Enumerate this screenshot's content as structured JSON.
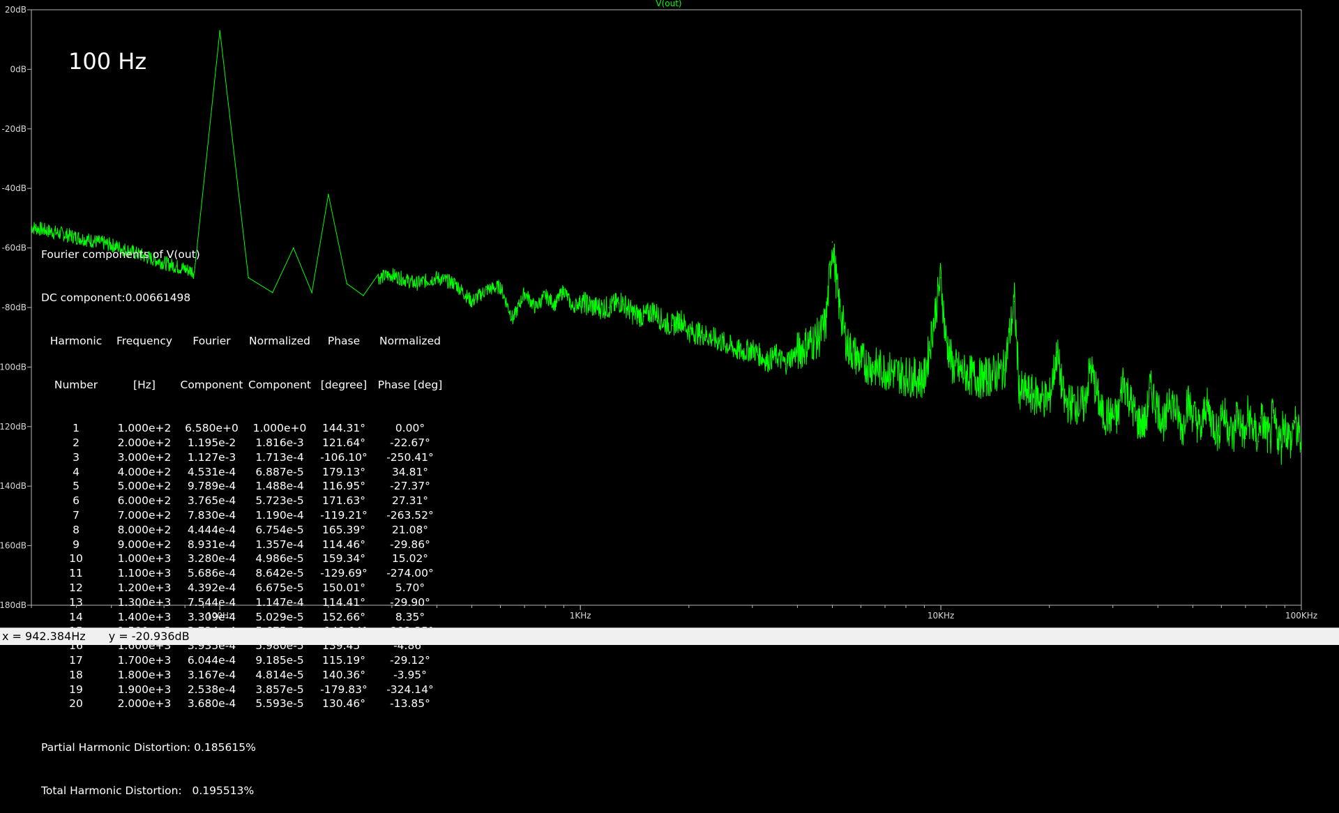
{
  "chart_data": {
    "type": "line",
    "title": "V(out)",
    "annotation": "100 Hz",
    "x_scale": "log",
    "xlim": [
      30,
      100000
    ],
    "ylim": [
      -180,
      20
    ],
    "x_ticks": [
      {
        "value": 100,
        "label": "100Hz"
      },
      {
        "value": 1000,
        "label": "1KHz"
      },
      {
        "value": 10000,
        "label": "10KHz"
      },
      {
        "value": 100000,
        "label": "100KHz"
      }
    ],
    "y_ticks": [
      {
        "value": 20,
        "label": "20dB"
      },
      {
        "value": 0,
        "label": "0dB"
      },
      {
        "value": -20,
        "label": "-20dB"
      },
      {
        "value": -40,
        "label": "-40dB"
      },
      {
        "value": -60,
        "label": "-60dB"
      },
      {
        "value": -80,
        "label": "-80dB"
      },
      {
        "value": -100,
        "label": "-100dB"
      },
      {
        "value": -120,
        "label": "-120dB"
      },
      {
        "value": -140,
        "label": "-140dB"
      },
      {
        "value": -160,
        "label": "-160dB"
      },
      {
        "value": -180,
        "label": "-180dB"
      }
    ],
    "grid": false,
    "trace_color": "#00ff00",
    "series": [
      {
        "name": "V(out)",
        "x": [
          30,
          50,
          70,
          85,
          100,
          120,
          140,
          160,
          180,
          200,
          225,
          250,
          275,
          300,
          350,
          400,
          450,
          500,
          550,
          600,
          650,
          700,
          750,
          800,
          850,
          900,
          950,
          1000,
          1100,
          1200,
          1300,
          1400,
          1500,
          1600,
          1700,
          1800,
          1900,
          2000,
          2200,
          2500,
          2800,
          3000,
          3300,
          3500,
          3700,
          3800,
          4000,
          4300,
          4600,
          4800,
          5000,
          5200,
          5500,
          6000,
          6500,
          7000,
          8000,
          9000,
          10000,
          10300,
          10800,
          11500,
          13000,
          15000,
          16000,
          16500,
          17500,
          20000,
          21000,
          22000,
          25000,
          26000,
          28000,
          31000,
          32000,
          35000,
          37000,
          38000,
          42000,
          43000,
          47000,
          48000,
          53000,
          54000,
          59000,
          60000,
          65000,
          66000,
          70000,
          71000,
          76000,
          77000,
          82000,
          83000,
          88000,
          89000,
          94000,
          95000,
          100000
        ],
        "y": [
          -53,
          -59,
          -65,
          -68,
          13,
          -70,
          -75,
          -60,
          -75,
          -42,
          -72,
          -76,
          -70,
          -69,
          -72,
          -70,
          -72,
          -78,
          -74,
          -73,
          -84,
          -75,
          -80,
          -76,
          -79,
          -74,
          -80,
          -78,
          -80,
          -80,
          -78,
          -82,
          -83,
          -81,
          -85,
          -86,
          -84,
          -88,
          -89,
          -92,
          -95,
          -94,
          -98,
          -96,
          -99,
          -97,
          -95,
          -92,
          -90,
          -85,
          -58,
          -78,
          -93,
          -98,
          -100,
          -101,
          -103,
          -104,
          -70,
          -90,
          -100,
          -102,
          -104,
          -101,
          -78,
          -108,
          -109,
          -111,
          -95,
          -112,
          -113,
          -100,
          -116,
          -117,
          -104,
          -118,
          -119,
          -107,
          -120,
          -109,
          -121,
          -111,
          -122,
          -112,
          -123,
          -114,
          -124,
          -115,
          -124,
          -116,
          -125,
          -117,
          -125,
          -117,
          -126,
          -118,
          -126,
          -118,
          -125
        ]
      }
    ]
  },
  "fourier": {
    "title": "Fourier components of V(out)",
    "dc": "DC component:0.00661498",
    "headers1": [
      "Harmonic",
      "Frequency",
      "Fourier",
      "Normalized",
      "Phase",
      "Normalized"
    ],
    "headers2": [
      "Number",
      "[Hz]",
      "Component",
      "Component",
      "[degree]",
      "Phase [deg]"
    ],
    "rows": [
      [
        "1",
        "1.000e+2",
        "6.580e+0",
        "1.000e+0",
        "144.31°",
        "0.00°"
      ],
      [
        "2",
        "2.000e+2",
        "1.195e-2",
        "1.816e-3",
        "121.64°",
        "-22.67°"
      ],
      [
        "3",
        "3.000e+2",
        "1.127e-3",
        "1.713e-4",
        "-106.10°",
        "-250.41°"
      ],
      [
        "4",
        "4.000e+2",
        "4.531e-4",
        "6.887e-5",
        "179.13°",
        "34.81°"
      ],
      [
        "5",
        "5.000e+2",
        "9.789e-4",
        "1.488e-4",
        "116.95°",
        "-27.37°"
      ],
      [
        "6",
        "6.000e+2",
        "3.765e-4",
        "5.723e-5",
        "171.63°",
        "27.31°"
      ],
      [
        "7",
        "7.000e+2",
        "7.830e-4",
        "1.190e-4",
        "-119.21°",
        "-263.52°"
      ],
      [
        "8",
        "8.000e+2",
        "4.444e-4",
        "6.754e-5",
        "165.39°",
        "21.08°"
      ],
      [
        "9",
        "9.000e+2",
        "8.931e-4",
        "1.357e-4",
        "114.46°",
        "-29.86°"
      ],
      [
        "10",
        "1.000e+3",
        "3.280e-4",
        "4.986e-5",
        "159.34°",
        "15.02°"
      ],
      [
        "11",
        "1.100e+3",
        "5.686e-4",
        "8.642e-5",
        "-129.69°",
        "-274.00°"
      ],
      [
        "12",
        "1.200e+3",
        "4.392e-4",
        "6.675e-5",
        "150.01°",
        "5.70°"
      ],
      [
        "13",
        "1.300e+3",
        "7.544e-4",
        "1.147e-4",
        "114.41°",
        "-29.90°"
      ],
      [
        "14",
        "1.400e+3",
        "3.309e-4",
        "5.029e-5",
        "152.66°",
        "8.35°"
      ],
      [
        "15",
        "1.500e+3",
        "3.734e-4",
        "5.675e-5",
        "-148.04°",
        "-292.35°"
      ],
      [
        "16",
        "1.600e+3",
        "3.935e-4",
        "5.980e-5",
        "139.45°",
        "-4.86°"
      ],
      [
        "17",
        "1.700e+3",
        "6.044e-4",
        "9.185e-5",
        "115.19°",
        "-29.12°"
      ],
      [
        "18",
        "1.800e+3",
        "3.167e-4",
        "4.814e-5",
        "140.36°",
        "-3.95°"
      ],
      [
        "19",
        "1.900e+3",
        "2.538e-4",
        "3.857e-5",
        "-179.83°",
        "-324.14°"
      ],
      [
        "20",
        "2.000e+3",
        "3.680e-4",
        "5.593e-5",
        "130.46°",
        "-13.85°"
      ]
    ],
    "phd": "Partial Harmonic Distortion: 0.185615%",
    "thd": "Total Harmonic Distortion:   0.195513%"
  },
  "status": {
    "x": "x = 942.384Hz",
    "y": "y = -20.936dB"
  }
}
